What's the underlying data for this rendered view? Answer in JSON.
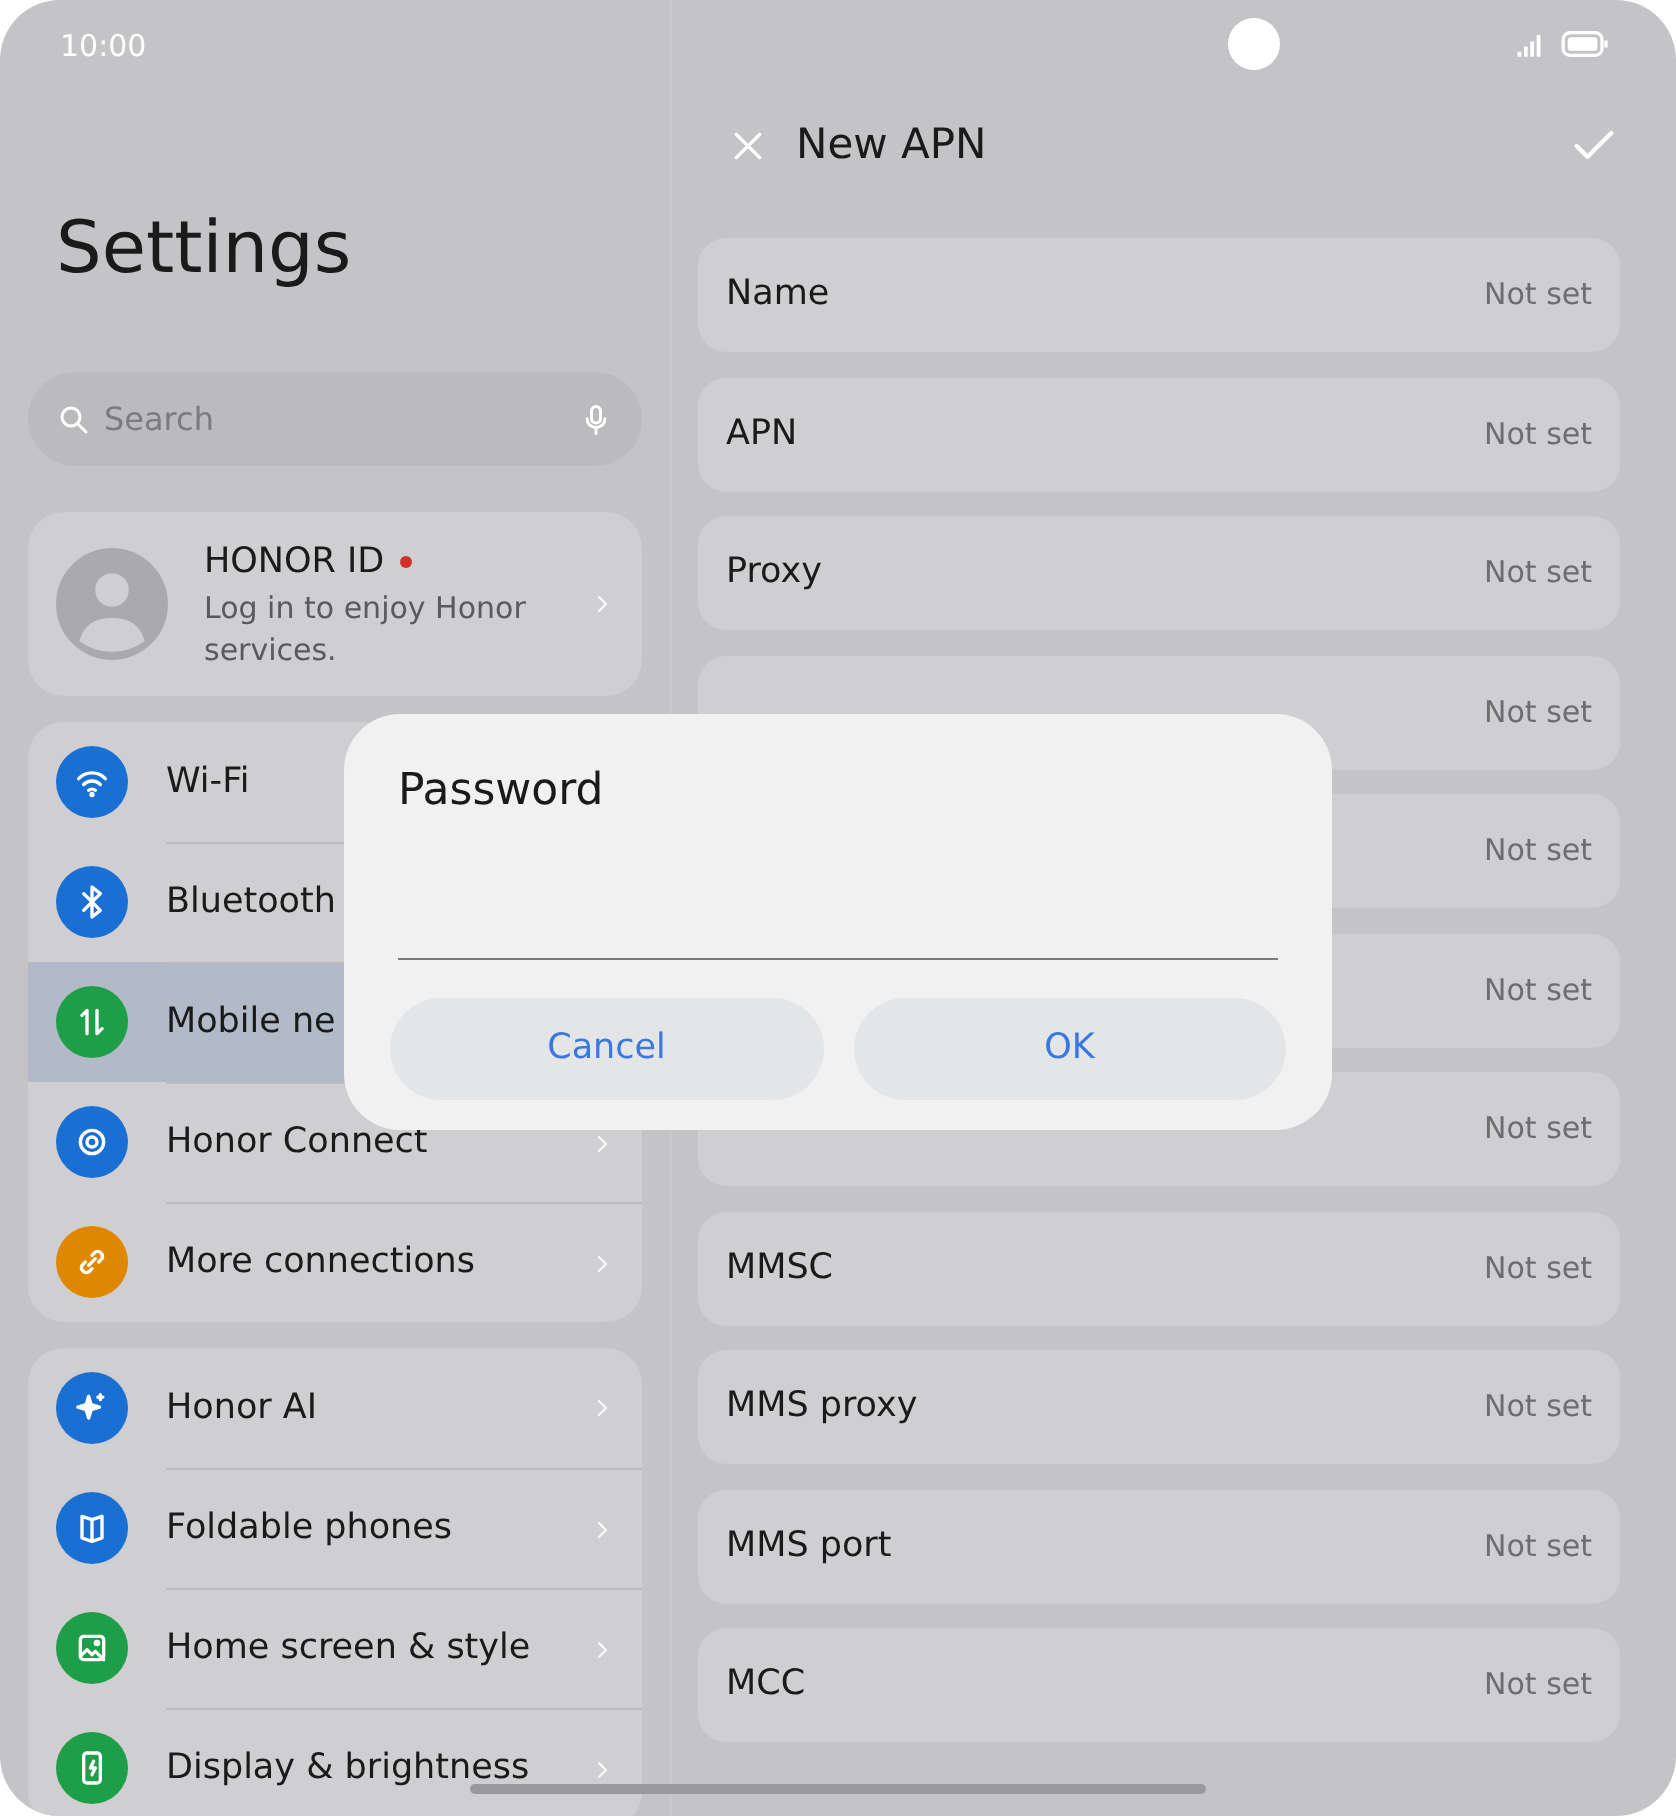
{
  "status_bar": {
    "time": "10:00"
  },
  "settings": {
    "title": "Settings",
    "search": {
      "placeholder": "Search"
    },
    "account": {
      "title": "HONOR ID",
      "subtitle": "Log in to enjoy Honor services.",
      "notification": true
    },
    "groups": [
      {
        "items": [
          {
            "label": "Wi-Fi",
            "kind": "wifi",
            "color": "#1a6fd3",
            "selected": false
          },
          {
            "label": "Bluetooth",
            "kind": "bluetooth",
            "color": "#1a6fd3",
            "selected": false
          },
          {
            "label": "Mobile ne",
            "kind": "mobile-data",
            "color": "#1e9e48",
            "selected": true
          },
          {
            "label": "Honor Connect",
            "kind": "connect",
            "color": "#1a6fd3",
            "selected": false
          },
          {
            "label": "More connections",
            "kind": "link",
            "color": "#e08700",
            "selected": false
          }
        ]
      },
      {
        "items": [
          {
            "label": "Honor AI",
            "kind": "sparkle",
            "color": "#1a6fd3",
            "selected": false
          },
          {
            "label": "Foldable phones",
            "kind": "fold",
            "color": "#1a6fd3",
            "selected": false
          },
          {
            "label": "Home screen & style",
            "kind": "image",
            "color": "#1e9e48",
            "selected": false
          },
          {
            "label": "Display & brightness",
            "kind": "display",
            "color": "#1e9e48",
            "selected": false
          }
        ]
      }
    ]
  },
  "apn": {
    "title": "New APN",
    "fields": [
      {
        "label": "Name",
        "value": "Not set"
      },
      {
        "label": "APN",
        "value": "Not set"
      },
      {
        "label": "Proxy",
        "value": "Not set"
      },
      {
        "value": "Not set"
      },
      {
        "value": "Not set"
      },
      {
        "value": "Not set"
      },
      {
        "value": "Not set"
      },
      {
        "label": "MMSC",
        "value": "Not set"
      },
      {
        "label": "MMS proxy",
        "value": "Not set"
      },
      {
        "label": "MMS port",
        "value": "Not set"
      },
      {
        "label": "MCC",
        "value": "Not set"
      }
    ]
  },
  "dialog": {
    "title": "Password",
    "buttons": [
      "Cancel",
      "OK"
    ]
  }
}
